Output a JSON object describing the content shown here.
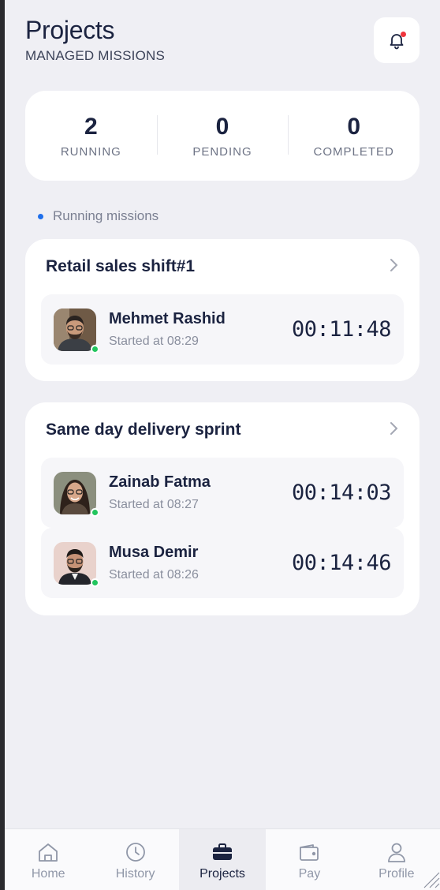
{
  "header": {
    "title": "Projects",
    "subtitle": "MANAGED MISSIONS"
  },
  "stats": [
    {
      "value": "2",
      "label": "RUNNING"
    },
    {
      "value": "0",
      "label": "PENDING"
    },
    {
      "value": "0",
      "label": "COMPLETED"
    }
  ],
  "section_label": "Running missions",
  "missions": [
    {
      "title": "Retail sales shift#1",
      "workers": [
        {
          "name": "Mehmet Rashid",
          "started": "Started at 08:29",
          "timer": "00:11:48"
        }
      ]
    },
    {
      "title": "Same day delivery sprint",
      "workers": [
        {
          "name": "Zainab Fatma",
          "started": "Started at 08:27",
          "timer": "00:14:03"
        },
        {
          "name": "Musa Demir",
          "started": "Started at 08:26",
          "timer": "00:14:46"
        }
      ]
    }
  ],
  "tabbar": {
    "active": "Projects",
    "items": [
      {
        "label": "Home",
        "icon": "home-icon"
      },
      {
        "label": "History",
        "icon": "clock-icon"
      },
      {
        "label": "Projects",
        "icon": "briefcase-icon"
      },
      {
        "label": "Pay",
        "icon": "wallet-icon"
      },
      {
        "label": "Profile",
        "icon": "user-icon"
      }
    ]
  },
  "colors": {
    "background": "#efeff4",
    "card": "#ffffff",
    "text_primary": "#1b2340",
    "accent_blue": "#1f6feb",
    "online_green": "#22c55e",
    "notification_red": "#f0343c"
  }
}
